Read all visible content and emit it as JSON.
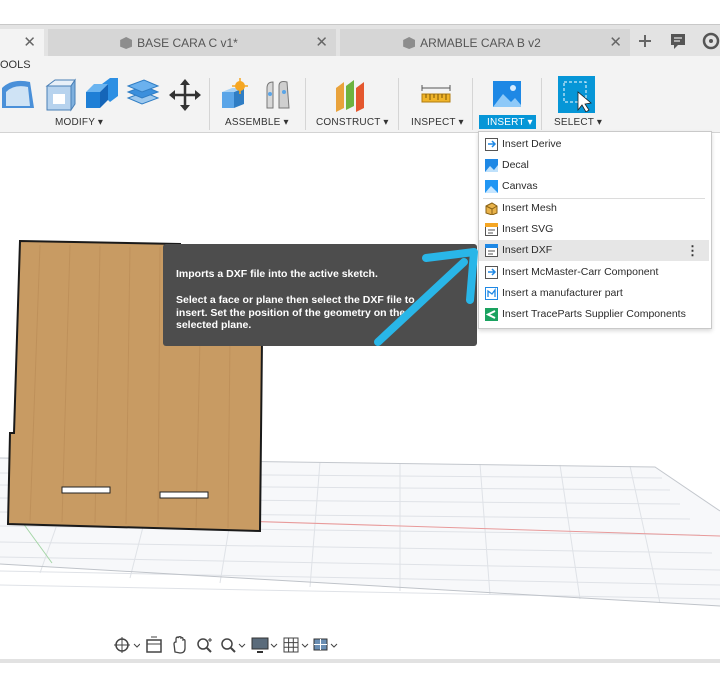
{
  "tabs": [
    {
      "label": "",
      "active": true
    },
    {
      "label": "BASE CARA C v1*",
      "active": false
    },
    {
      "label": "ARMABLE CARA B v2",
      "active": false
    }
  ],
  "tab_close_glyph": "✕",
  "tools_label": "OOLS",
  "toolbar_groups": {
    "modify": "MODIFY ▾",
    "assemble": "ASSEMBLE ▾",
    "construct": "CONSTRUCT ▾",
    "inspect": "INSPECT ▾",
    "insert": "INSERT ▾",
    "select": "SELECT ▾"
  },
  "insert_menu": {
    "items": [
      {
        "label": "Insert Derive",
        "icon": "derive-icon"
      },
      {
        "label": "Decal",
        "icon": "decal-icon"
      },
      {
        "label": "Canvas",
        "icon": "canvas-icon"
      },
      {
        "label": "Insert Mesh",
        "icon": "mesh-icon"
      },
      {
        "label": "Insert SVG",
        "icon": "svg-icon"
      },
      {
        "label": "Insert DXF",
        "icon": "dxf-icon",
        "highlighted": true
      },
      {
        "label": "Insert McMaster-Carr Component",
        "icon": "mcmaster-icon"
      },
      {
        "label": "Insert a manufacturer part",
        "icon": "manufacturer-icon"
      },
      {
        "label": "Insert TraceParts Supplier Components",
        "icon": "traceparts-icon"
      }
    ],
    "more_glyph": "⋮"
  },
  "tooltip": {
    "line1": "Imports a DXF file into the active sketch.",
    "line2": "Select a face or plane then select the DXF file to",
    "line3": "insert. Set the position of the geometry on the",
    "line4": "selected plane."
  },
  "colors": {
    "accent": "#0696d7",
    "arrow": "#29b6e8",
    "tooltip_bg": "#4d4d4d",
    "wood": "#c89b63"
  },
  "navbar_icons": [
    "orbit-icon",
    "pan-icon",
    "zoom-icon",
    "fit-icon",
    "display-icon",
    "grid-icon",
    "viewports-icon"
  ]
}
